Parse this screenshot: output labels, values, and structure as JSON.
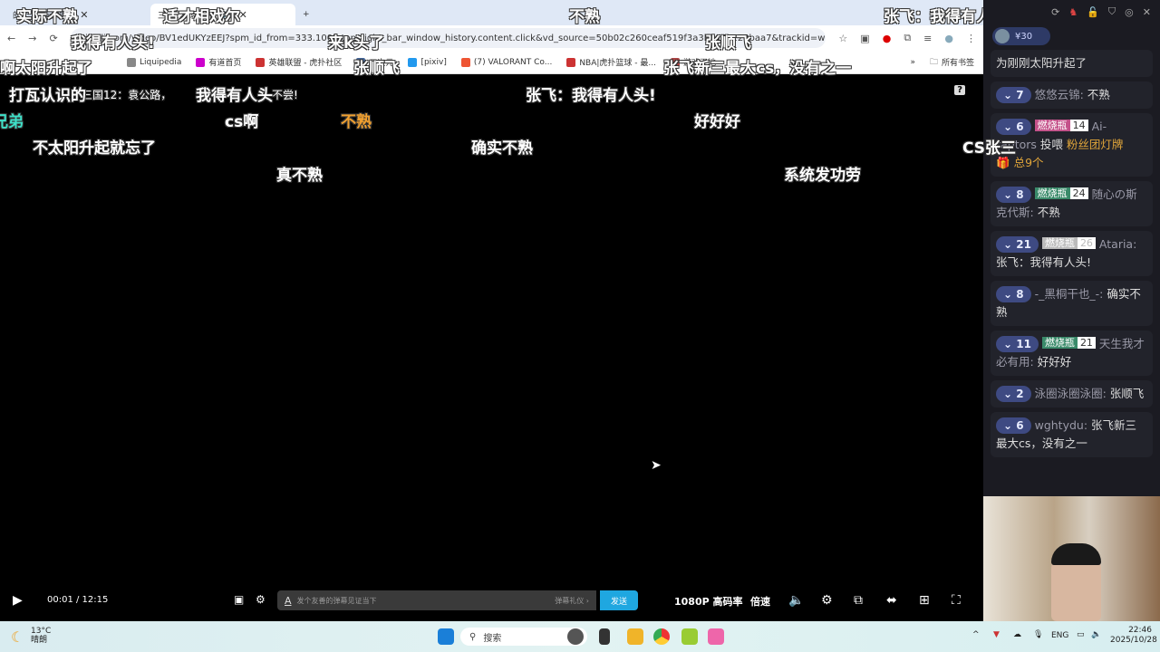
{
  "browser": {
    "tabs": [
      {
        "title": "的个人空间-哔哩"
      },
      {
        "title": "三国12: 袁公路"
      }
    ],
    "new_tab": "+",
    "url": "bilibili.com/video/BV1edUKYzEEJ?spm_id_from=333.1007.top_right_bar_window_history.content.click&vd_source=50b02c260ceaf519f3a3bca79228baa7&trackid=web_related_0.router-related-2206146...",
    "bookmarks": [
      "Liquipedia",
      "有道首页",
      "英雄联盟 - 虎扑社区",
      "二次元",
      "[pixiv]",
      "(7) VALORANT Co...",
      "NBA|虎扑篮球 - 最...",
      "游戏天地"
    ],
    "bookmarks_more": "»",
    "all_bookmarks": "所有书签"
  },
  "danmaku": [
    "实际不熟",
    "适才相戏尔",
    "不熟",
    "张飞：我得有人头",
    "我得有人头!",
    "来k头了",
    "张顺飞",
    "啊太阳升起了",
    "张顺飞",
    "张飞新三最大cs，没有之一",
    "打瓦认识的",
    "我得有人头",
    "张飞：我得有人头!",
    "兄弟",
    "cs啊",
    "不熟",
    "好好好",
    "不太阳升起就忘了",
    "确实不熟",
    "CS张三",
    "真不熟",
    "系统发功劳",
    "三国12：袁公路，",
    "不尝!"
  ],
  "colors": {
    "cyan": "#3ee0c8",
    "orange": "#f0a030",
    "send": "#1fa7e0"
  },
  "player": {
    "time": "00:01 / 12:15",
    "danmaku_placeholder": "发个友善的弹幕见证当下",
    "etiquette": "弹幕礼仪 ›",
    "send": "发送",
    "quality": "1080P 高码率",
    "speed": "倍速",
    "help": "?"
  },
  "panel": {
    "gift": "¥30",
    "messages": [
      {
        "level": "",
        "badge": "",
        "badge_level": "",
        "user": "",
        "text": "为刚刚太阳升起了"
      },
      {
        "level": "7",
        "badge": "",
        "badge_level": "",
        "user": "悠悠云锦:",
        "text": "不熟"
      },
      {
        "level": "6",
        "badge": "燃烧瓶",
        "badge_level": "14",
        "user": "Ai-raptors",
        "text": "投喂",
        "gift": "粉丝团灯牌",
        "gift_count": "总9个"
      },
      {
        "level": "8",
        "badge": "燃烧瓶",
        "badge_level": "24",
        "user": "随心の斯克代斯:",
        "text": "不熟"
      },
      {
        "level": "21",
        "badge": "燃烧瓶",
        "badge_level": "26",
        "user": "Ataria:",
        "text": "张飞：我得有人头!"
      },
      {
        "level": "8",
        "badge": "",
        "badge_level": "",
        "user": "-_黑桐干也_-:",
        "text": "确实不熟"
      },
      {
        "level": "11",
        "badge": "燃烧瓶",
        "badge_level": "21",
        "user": "天生我才必有用:",
        "text": "好好好"
      },
      {
        "level": "2",
        "badge": "",
        "badge_level": "",
        "user": "泳圈泳圈泳圈:",
        "text": "张顺飞"
      },
      {
        "level": "6",
        "badge": "",
        "badge_level": "",
        "user": "wghtydu:",
        "text": "张飞新三最大cs，没有之一"
      }
    ]
  },
  "taskbar": {
    "weather_temp": "13°C",
    "weather_desc": "晴朗",
    "search": "搜索",
    "lang": "ENG",
    "time": "22:46",
    "date": "2025/10/28"
  }
}
